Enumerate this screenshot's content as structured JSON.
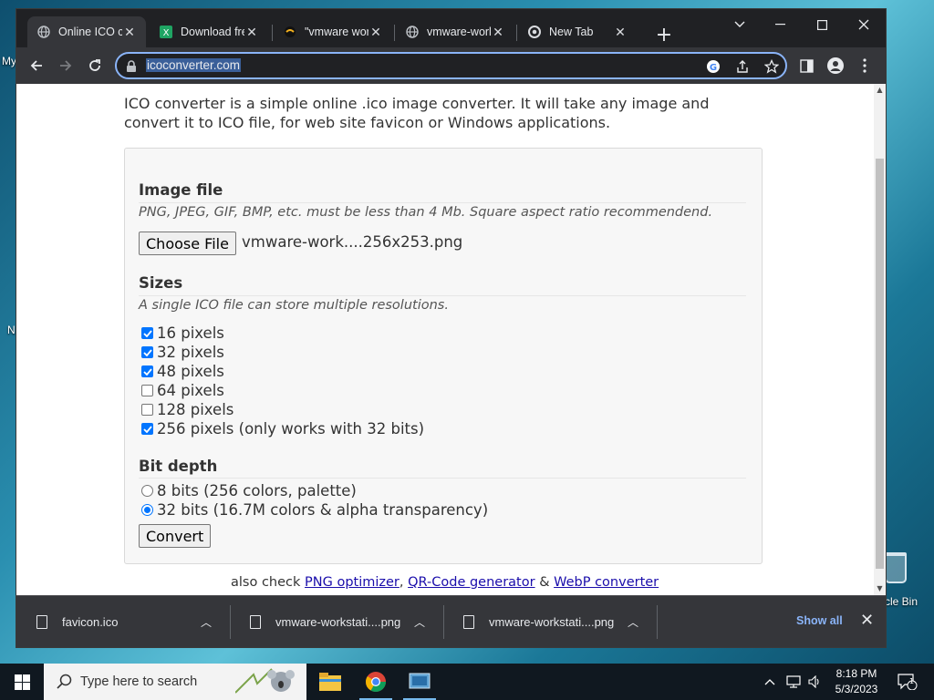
{
  "desktop": {
    "left_label_1": "My",
    "left_label_2": "N",
    "recycle_label": "cle Bin"
  },
  "browser": {
    "tabs": [
      {
        "title": "Online ICO c",
        "active": true
      },
      {
        "title": "Download fre",
        "active": false
      },
      {
        "title": "\"vmware wor",
        "active": false
      },
      {
        "title": "vmware-work",
        "active": false
      },
      {
        "title": "New Tab",
        "active": false
      }
    ],
    "new_tab_symbol": "+",
    "url": "icoconverter.com"
  },
  "page": {
    "intro": "ICO converter is a simple online .ico image converter. It will take any image and convert it to ICO file, for web site favicon or Windows applications.",
    "image_file": {
      "title": "Image file",
      "hint": "PNG, JPEG, GIF, BMP, etc. must be less than 4 Mb. Square aspect ratio recommendend.",
      "choose_label": "Choose File",
      "filename": "vmware-work....256x253.png"
    },
    "sizes": {
      "title": "Sizes",
      "hint": "A single ICO file can store multiple resolutions.",
      "options": [
        {
          "label": "16 pixels",
          "checked": true
        },
        {
          "label": "32 pixels",
          "checked": true
        },
        {
          "label": "48 pixels",
          "checked": true
        },
        {
          "label": "64 pixels",
          "checked": false
        },
        {
          "label": "128 pixels",
          "checked": false
        },
        {
          "label": "256 pixels (only works with 32 bits)",
          "checked": true
        }
      ]
    },
    "bit_depth": {
      "title": "Bit depth",
      "options": [
        {
          "label": "8 bits (256 colors, palette)",
          "selected": false
        },
        {
          "label": "32 bits (16.7M colors & alpha transparency)",
          "selected": true
        }
      ]
    },
    "convert_label": "Convert",
    "also": {
      "prefix": "also check",
      "link1": "PNG optimizer",
      "sep1": ",",
      "link2": "QR-Code generator",
      "sep2": "&",
      "link3": "WebP converter"
    }
  },
  "downloads": {
    "items": [
      "favicon.ico",
      "vmware-workstati....png",
      "vmware-workstati....png"
    ],
    "show_all": "Show all"
  },
  "taskbar": {
    "search_placeholder": "Type here to search",
    "time": "8:18 PM",
    "date": "5/3/2023",
    "notification_count": "1"
  },
  "colors": {
    "accent": "#0075ff",
    "link": "#1a0dab",
    "chrome_dark": "#202124",
    "chrome_toolbar": "#35363a",
    "omnibox_focus": "#8ab4f8"
  }
}
